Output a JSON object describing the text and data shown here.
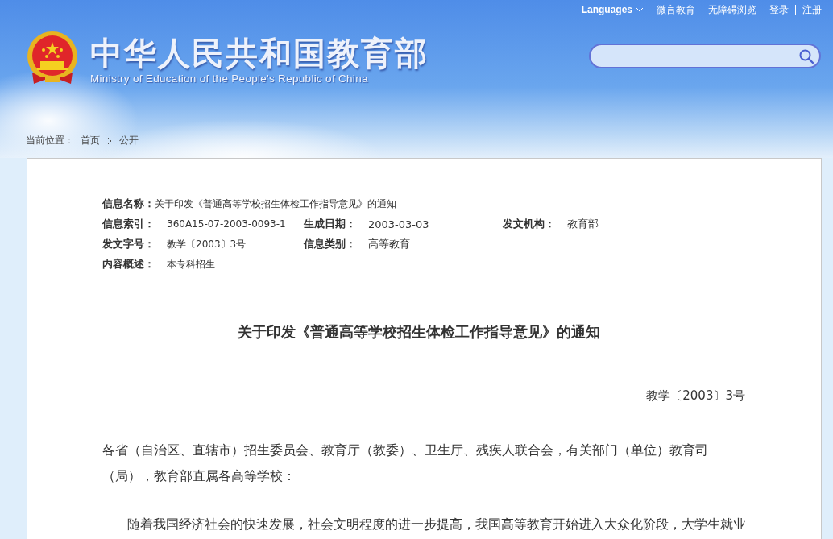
{
  "header": {
    "top_links": [
      {
        "kind": "dropdown",
        "label": "Languages"
      },
      {
        "kind": "link",
        "label": "微言教育"
      },
      {
        "kind": "link",
        "label": "无障碍浏览"
      },
      {
        "kind": "link",
        "label": "登录"
      },
      {
        "kind": "separated",
        "label": "注册"
      }
    ],
    "title": "中华人民共和国教育部",
    "subtitle": "Ministry of Education of the People's Republic of China"
  },
  "breadcrumb": {
    "label": "当前位置：",
    "items": [
      "首页",
      "公开"
    ]
  },
  "meta": [
    [
      {
        "label": "信息名称：",
        "value": "关于印发《普通高等学校招生体检工作指导意见》的通知"
      }
    ],
    [
      {
        "label": "信息索引：",
        "value": "360A15-07-2003-0093-1"
      },
      {
        "label": "生成日期：",
        "value": "2003-03-03"
      },
      {
        "label": "发文机构：",
        "value": "教育部"
      }
    ],
    [
      {
        "label": "发文字号：",
        "value": "教学〔2003〕3号"
      },
      {
        "label": "信息类别：",
        "value": "高等教育"
      }
    ],
    [
      {
        "label": "内容概述：",
        "value": "本专科招生"
      }
    ]
  ],
  "article": {
    "title": "关于印发《普通高等学校招生体检工作指导意见》的通知",
    "doc_number": "教学〔2003〕3号",
    "salutation": "各省（自治区、直辖市）招生委员会、教育厅（教委）、卫生厅、残疾人联合会，有关部门（单位）教育司（局），教育部直属各高等学校：",
    "paragraphs": [
      "随着我国经济社会的快速发展，社会文明程度的进一步提高，我国高等教育开始进入大众化阶段，大学生就业"
    ]
  }
}
